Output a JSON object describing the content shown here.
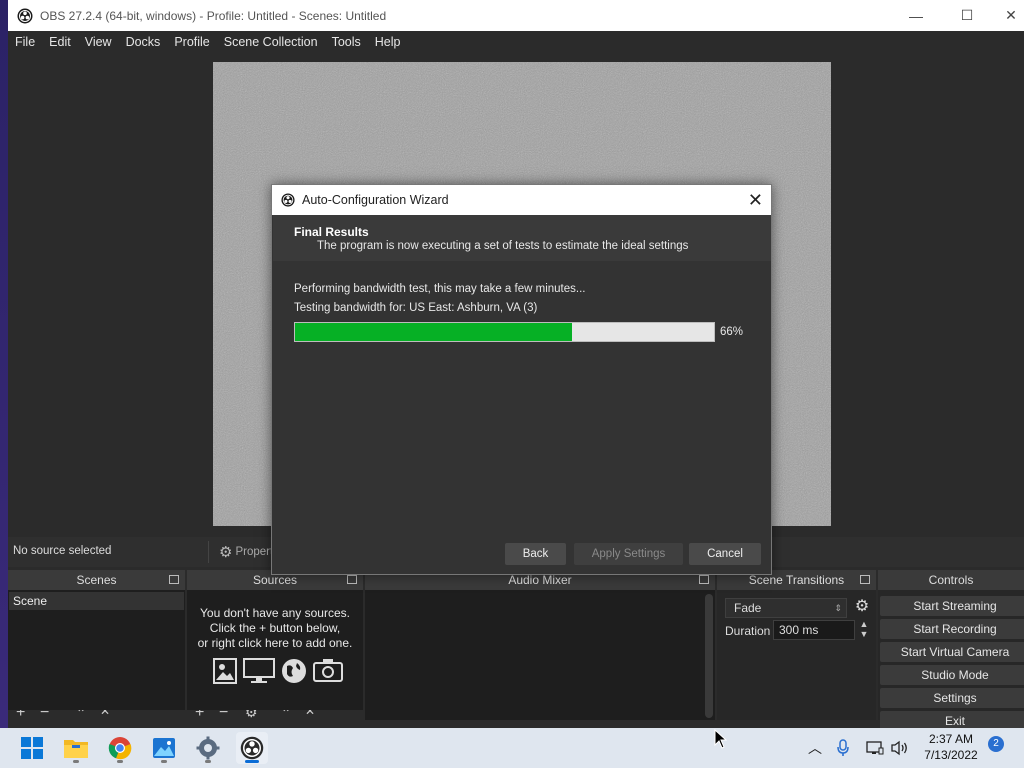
{
  "window": {
    "title": "OBS 27.2.4 (64-bit, windows) - Profile: Untitled - Scenes: Untitled",
    "min_glyph": "—",
    "max_glyph": "☐",
    "close_glyph": "✕"
  },
  "menu": [
    "File",
    "Edit",
    "View",
    "Docks",
    "Profile",
    "Scene Collection",
    "Tools",
    "Help"
  ],
  "props_bar": {
    "no_source": "No source selected",
    "properties": "Propert"
  },
  "docks": {
    "scenes": {
      "title": "Scenes",
      "items": [
        "Scene"
      ]
    },
    "sources": {
      "title": "Sources",
      "empty_line1": "You don't have any sources.",
      "empty_line2": "Click the + button below,",
      "empty_line3": "or right click here to add one."
    },
    "audio_mixer": {
      "title": "Audio Mixer"
    },
    "scene_transitions": {
      "title": "Scene Transitions",
      "transition": "Fade",
      "duration_label": "Duration",
      "duration_value": "300 ms"
    },
    "controls": {
      "title": "Controls",
      "buttons": [
        "Start Streaming",
        "Start Recording",
        "Start Virtual Camera",
        "Studio Mode",
        "Settings",
        "Exit"
      ]
    }
  },
  "dialog": {
    "title": "Auto-Configuration Wizard",
    "close_glyph": "✕",
    "heading": "Final Results",
    "subheading": "The program is now executing a set of tests to estimate the ideal settings",
    "status": "Performing bandwidth test, this may take a few minutes...",
    "testing": "Testing bandwidth for: US East: Ashburn, VA (3)",
    "progress": 66,
    "progress_label": "66%",
    "buttons": {
      "back": "Back",
      "apply": "Apply Settings",
      "cancel": "Cancel"
    }
  },
  "taskbar": {
    "clock_time": "2:37 AM",
    "clock_date": "7/13/2022",
    "notifications": "2"
  },
  "colors": {
    "progress_fill": "#06b025",
    "accent": "#0a6cd6"
  }
}
